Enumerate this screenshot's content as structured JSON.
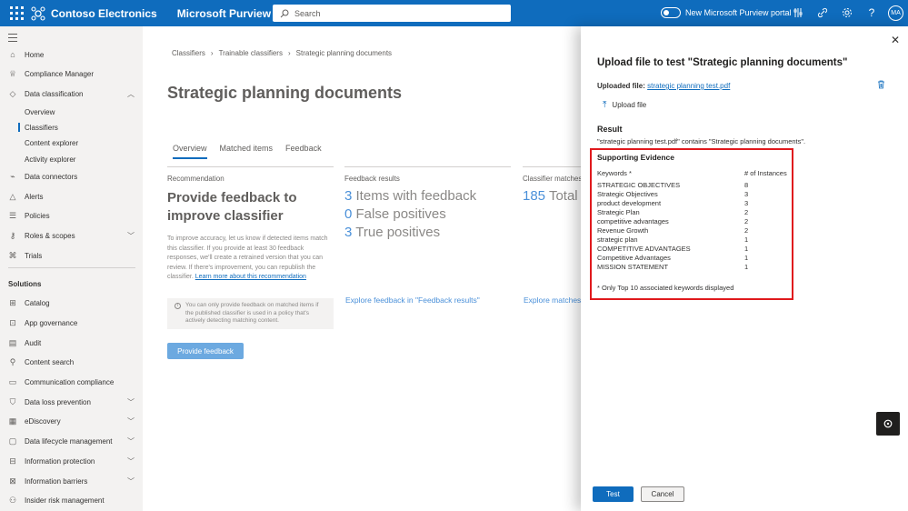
{
  "topbar": {
    "org_name": "Contoso Electronics",
    "product_name": "Microsoft Purview",
    "search_placeholder": "Search",
    "toggle_label": "New Microsoft Purview portal",
    "avatar_initials": "MA",
    "brand_color": "#0f6cbd",
    "icons": [
      "settings-sliders-icon",
      "share-icon",
      "gear-icon",
      "help-icon"
    ]
  },
  "nav": {
    "items": [
      {
        "label": "Home",
        "icon": "home-icon"
      },
      {
        "label": "Compliance Manager",
        "icon": "trophy-icon"
      },
      {
        "label": "Data classification",
        "icon": "tag-icon",
        "expanded": true
      },
      {
        "label": "Overview"
      },
      {
        "label": "Classifiers"
      },
      {
        "label": "Content explorer"
      },
      {
        "label": "Activity explorer"
      },
      {
        "label": "Data connectors",
        "icon": "plug-icon"
      },
      {
        "label": "Alerts",
        "icon": "alert-icon"
      },
      {
        "label": "Policies",
        "icon": "policy-icon"
      },
      {
        "label": "Roles & scopes",
        "icon": "key-icon"
      },
      {
        "label": "Trials",
        "icon": "trial-icon"
      }
    ],
    "solutions_label": "Solutions",
    "solutions": [
      {
        "label": "Catalog",
        "icon": "grid-icon"
      },
      {
        "label": "App governance",
        "icon": "app-icon"
      },
      {
        "label": "Audit",
        "icon": "audit-icon"
      },
      {
        "label": "Content search",
        "icon": "search-icon"
      },
      {
        "label": "Communication compliance",
        "icon": "chat-icon"
      },
      {
        "label": "Data loss prevention",
        "icon": "shield-icon"
      },
      {
        "label": "eDiscovery",
        "icon": "discovery-icon"
      },
      {
        "label": "Data lifecycle management",
        "icon": "lifecycle-icon"
      },
      {
        "label": "Information protection",
        "icon": "lock-icon"
      },
      {
        "label": "Information barriers",
        "icon": "barrier-icon"
      },
      {
        "label": "Insider risk management",
        "icon": "person-icon"
      }
    ]
  },
  "main": {
    "breadcrumb": [
      "Classifiers",
      "Trainable classifiers",
      "Strategic planning documents"
    ],
    "title": "Strategic planning documents",
    "tabs": [
      "Overview",
      "Matched items",
      "Feedback"
    ],
    "recommendation": {
      "heading": "Recommendation",
      "title": "Provide feedback to improve classifier",
      "body": "To improve accuracy, let us know if detected items match this classifier. If you provide at least 30 feedback responses, we'll create a retrained version that you can review. If there's improvement, you can republish the classifier.",
      "link": "Learn more about this recommendation"
    },
    "feedback_results": {
      "heading": "Feedback results",
      "lines": [
        {
          "num": "3",
          "label": "Items with feedback"
        },
        {
          "num": "0",
          "label": "False positives"
        },
        {
          "num": "3",
          "label": "True positives"
        }
      ],
      "link": "Explore feedback in \"Feedback results\""
    },
    "classifier_matches": {
      "heading": "Classifier matches",
      "num": "185",
      "label": "Total",
      "link": "Explore matches"
    },
    "info_text": "You can only provide feedback on matched items if the published classifier is used in a policy that's actively detecting matching content.",
    "provide_button": "Provide feedback"
  },
  "panel": {
    "title": "Upload file to test \"Strategic planning documents\"",
    "uploaded_label": "Uploaded file:",
    "uploaded_file": "strategic planning test.pdf",
    "upload_button": "Upload file",
    "result_heading": "Result",
    "result_text": "\"strategic planning test.pdf\" contains \"Strategic planning documents\".",
    "evidence": {
      "title": "Supporting Evidence",
      "col_keywords": "Keywords *",
      "col_instances": "# of Instances",
      "rows": [
        {
          "keyword": "STRATEGIC OBJECTIVES",
          "count": "8"
        },
        {
          "keyword": "Strategic Objectives",
          "count": "3"
        },
        {
          "keyword": "product development",
          "count": "3"
        },
        {
          "keyword": "Strategic Plan",
          "count": "2"
        },
        {
          "keyword": "competitive advantages",
          "count": "2"
        },
        {
          "keyword": "Revenue Growth",
          "count": "2"
        },
        {
          "keyword": "strategic plan",
          "count": "1"
        },
        {
          "keyword": "COMPETITIVE ADVANTAGES",
          "count": "1"
        },
        {
          "keyword": "Competitive Advantages",
          "count": "1"
        },
        {
          "keyword": "MISSION STATEMENT",
          "count": "1"
        }
      ],
      "note": "* Only Top 10 associated keywords displayed",
      "highlight_color": "#e0191d"
    },
    "test_button": "Test",
    "cancel_button": "Cancel"
  }
}
